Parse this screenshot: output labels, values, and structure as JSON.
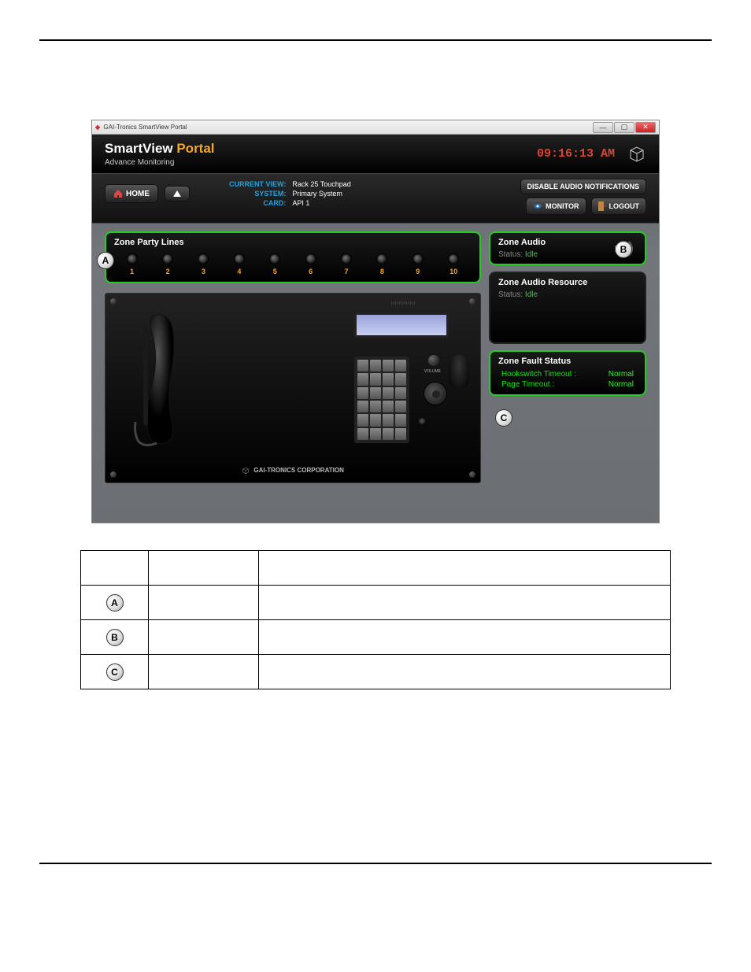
{
  "window": {
    "title": "GAI-Tronics SmartView Portal"
  },
  "brand": {
    "name_a": "SmartView ",
    "name_b": "Portal",
    "subtitle": "Advance Monitoring"
  },
  "clock": "09:16:13 AM",
  "current_view": {
    "labels": {
      "view": "CURRENT VIEW:",
      "system": "SYSTEM:",
      "card": "CARD:"
    },
    "values": {
      "view": "Rack 25 Touchpad",
      "system": "Primary System",
      "card": "API 1"
    }
  },
  "buttons": {
    "home": "HOME",
    "disable_audio": "DISABLE AUDIO NOTIFICATIONS",
    "monitor": "MONITOR",
    "logout": "LOGOUT"
  },
  "zone_party": {
    "title": "Zone Party Lines",
    "numbers": [
      "1",
      "2",
      "3",
      "4",
      "5",
      "6",
      "7",
      "8",
      "9",
      "10"
    ]
  },
  "zone_audio": {
    "title": "Zone Audio",
    "status_label": "Status:",
    "status_value": "Idle"
  },
  "zone_audio_resource": {
    "title": "Zone Audio Resource",
    "status_label": "Status:",
    "status_value": "Idle"
  },
  "zone_fault": {
    "title": "Zone Fault Status",
    "rows": [
      {
        "label": "Hookswitch Timeout :",
        "value": "Normal"
      },
      {
        "label": "Page Timeout :",
        "value": "Normal"
      }
    ]
  },
  "device": {
    "footer": "GAI-TRONICS CORPORATION",
    "volume_label": "VOLUME"
  },
  "badges": {
    "A": "A",
    "B": "B",
    "C": "C"
  }
}
